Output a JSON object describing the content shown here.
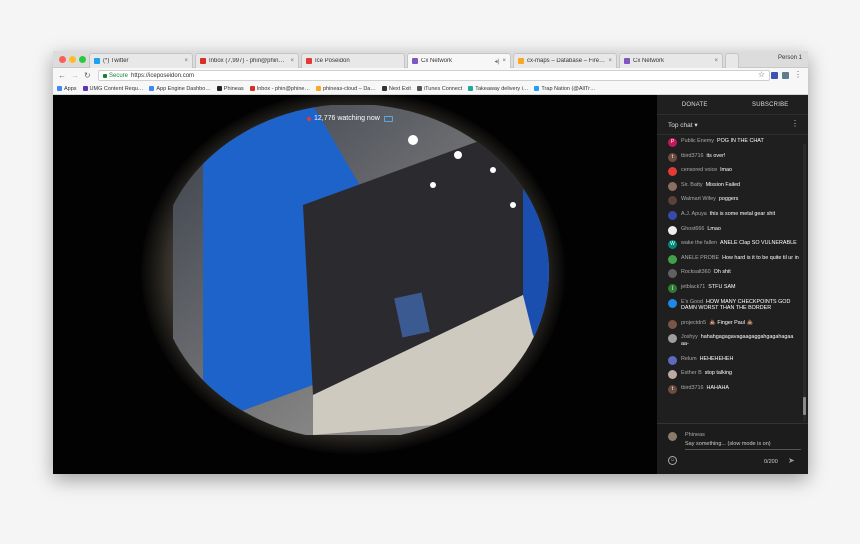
{
  "browser": {
    "tabs": [
      {
        "title": "(*) Twitter",
        "color": "#1da1f2"
      },
      {
        "title": "Inbox (7,997) - phin@phineas…",
        "color": "#d93025"
      },
      {
        "title": "Ice Poseidon",
        "color": "#e53935"
      },
      {
        "title": "Cx Network",
        "color": "#7e57c2"
      },
      {
        "title": "cx-maps – Database – Fireba…",
        "color": "#f9a825"
      },
      {
        "title": "Cx Network",
        "color": "#7e57c2"
      }
    ],
    "person": "Person 1",
    "url_secure": "Secure",
    "url": "https://iceposeidon.com",
    "bookmarks": [
      {
        "label": "Apps",
        "color": "#4285f4"
      },
      {
        "label": "UMG Content Requ…",
        "color": "#5e35b1"
      },
      {
        "label": "App Engine Dashbo…",
        "color": "#4285f4"
      },
      {
        "label": "Phineas",
        "color": "#222222"
      },
      {
        "label": "Inbox - phin@phine…",
        "color": "#d93025"
      },
      {
        "label": "phineas-cloud – Da…",
        "color": "#f9a825"
      },
      {
        "label": "Next Exit",
        "color": "#333333"
      },
      {
        "label": "iTunes Connect",
        "color": "#555555"
      },
      {
        "label": "Takeaway delivery i…",
        "color": "#26a69a"
      },
      {
        "label": "Trap Nation (@AllTr…",
        "color": "#1da1f2"
      }
    ]
  },
  "stream": {
    "watching": "12,776 watching now"
  },
  "sidebar": {
    "donate": "DONATE",
    "subscribe": "SUBSCRIBE",
    "top_chat": "Top chat ▾",
    "messages": [
      {
        "author": "Public Enemy",
        "text": "POG IN THE CHAT",
        "color": "#c2185b",
        "initial": "P"
      },
      {
        "author": "tbird3716",
        "text": "its over!",
        "color": "#6d4c41",
        "initial": "t"
      },
      {
        "author": "censored voice",
        "text": "lmao",
        "color": "#e53935",
        "initial": ""
      },
      {
        "author": "Sir. Batty",
        "text": "Mission Failed",
        "color": "#8d6e63",
        "initial": ""
      },
      {
        "author": "Walmart Wifey",
        "text": "poggers",
        "color": "#5d4037",
        "initial": ""
      },
      {
        "author": "A.J. Apuya",
        "text": "this is some metal gear shit",
        "color": "#3949ab",
        "initial": ""
      },
      {
        "author": "Ghost666",
        "text": "Lmao",
        "color": "#eeeeee",
        "initial": ""
      },
      {
        "author": "wake the fallen",
        "text": "ANELE Clap SO VULNERABLE",
        "color": "#00897b",
        "initial": "W"
      },
      {
        "author": "ANELE PROBE",
        "text": "How hard is it to be quite til ur in",
        "color": "#43a047",
        "initial": ""
      },
      {
        "author": "Rocksalt360",
        "text": "Oh shit",
        "color": "#616161",
        "initial": ""
      },
      {
        "author": "jetblack71",
        "text": "STFU SAM",
        "color": "#2e7d32",
        "initial": "j"
      },
      {
        "author": "E's Good",
        "text": "HOW MANY CHECKPOINTS GOD DAMN WORST THAN THE BORDER",
        "color": "#1e88e5",
        "initial": ""
      },
      {
        "author": "projectdn5",
        "text": "💩 Finger Paul 💩",
        "color": "#795548",
        "initial": ""
      },
      {
        "author": "Joshyy",
        "text": "hahahgagagavagaagaggahgagahagaa aa-",
        "color": "#9e9e9e",
        "initial": ""
      },
      {
        "author": "Relum",
        "text": "HEHEHEHEH",
        "color": "#5c6bc0",
        "initial": ""
      },
      {
        "author": "Esther B",
        "text": "stop talking",
        "color": "#bcaaa4",
        "initial": ""
      },
      {
        "author": "tbird3716",
        "text": "HAHAHA",
        "color": "#6d4c41",
        "initial": "t"
      }
    ],
    "compose_name": "Phineas",
    "compose_placeholder": "Say something... (slow mode is on)",
    "char_count": "0/200"
  }
}
